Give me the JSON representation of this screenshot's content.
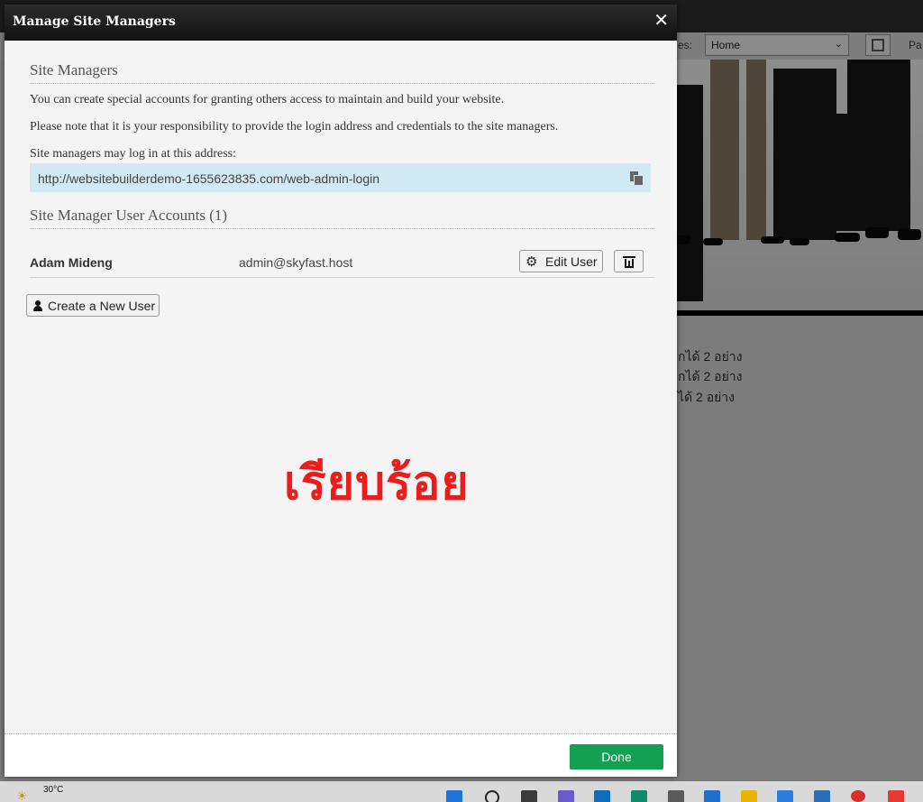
{
  "modal": {
    "title": "Manage Site Managers",
    "close_glyph": "✕",
    "site_managers_heading": "Site Managers",
    "intro_text": "You can create special accounts for granting others access to maintain and build your website.",
    "note_text": "Please note that it is your responsibility to provide the login address and credentials to the site managers.",
    "login_label": "Site managers may log in at this address:",
    "login_url": "http://websitebuilderdemo-1655623835.com/web-admin-login",
    "accounts_heading": "Site Manager User Accounts (1)",
    "users": [
      {
        "name": "Adam Mideng",
        "email": "admin@skyfast.host"
      }
    ],
    "edit_user_label": "Edit User",
    "create_user_label": "Create a New User",
    "done_label": "Done",
    "annotation_text": "เรียบร้อย"
  },
  "background": {
    "pages_label": "es:",
    "page_select_value": "Home",
    "pa_label": "Pa",
    "text_lines": [
      "กได้ 2 อย่าง",
      "กได้ 2 อย่าง",
      "ได้ 2 อย่าง"
    ]
  },
  "taskbar": {
    "temperature": "30°C"
  },
  "colors": {
    "accent_done": "#14a052",
    "url_box": "#d0e9f3",
    "annotation": "#ee1b1b"
  },
  "icons": {
    "close": "close-icon",
    "copy": "copy-icon",
    "gear": "gear-icon",
    "trash": "trash-icon",
    "user": "user-icon"
  }
}
